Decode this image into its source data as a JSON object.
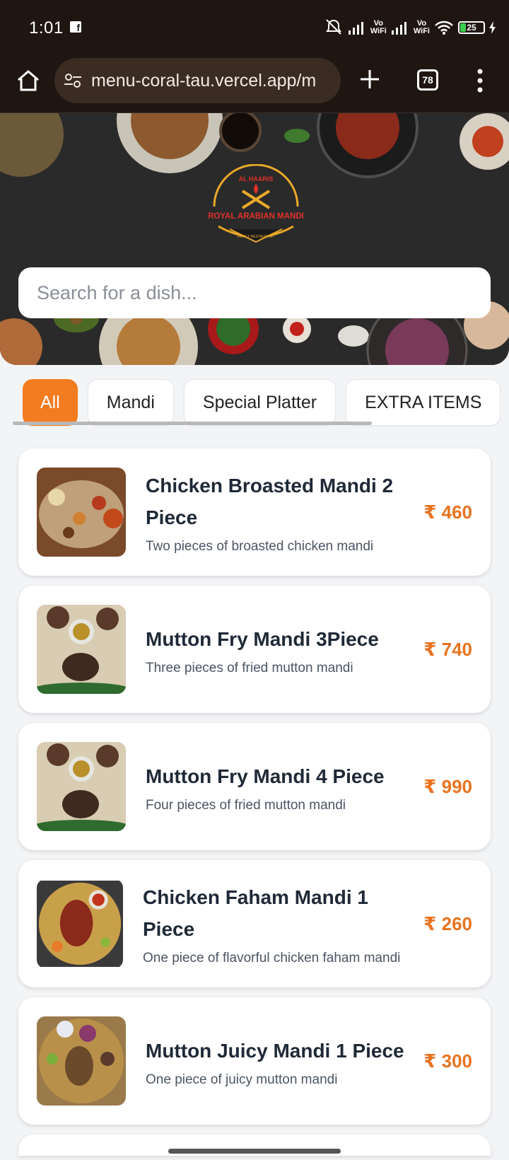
{
  "status_bar": {
    "time": "1:01",
    "battery": "25",
    "vowifi_1": "Vo\nWiFi",
    "vowifi_2": "Vo\nWiFi"
  },
  "browser": {
    "url": "menu-coral-tau.vercel.app/m",
    "tab_count": "78"
  },
  "hero": {
    "logo_top": "AL HAARIS",
    "logo_main": "ROYAL ARABIAN MANDI",
    "logo_sub": "FAMILY RESTAURANT"
  },
  "search": {
    "placeholder": "Search for a dish..."
  },
  "categories": [
    {
      "label": "All",
      "active": true
    },
    {
      "label": "Mandi",
      "active": false
    },
    {
      "label": "Special Platter",
      "active": false
    },
    {
      "label": "EXTRA ITEMS",
      "active": false
    }
  ],
  "menu_items": [
    {
      "name": "Chicken Broasted Mandi 2 Piece",
      "description": "Two pieces of broasted chicken mandi",
      "price": "₹ 460"
    },
    {
      "name": "Mutton Fry Mandi 3Piece",
      "description": "Three pieces of fried mutton mandi",
      "price": "₹ 740"
    },
    {
      "name": "Mutton Fry Mandi 4 Piece",
      "description": "Four pieces of fried mutton mandi",
      "price": "₹ 990"
    },
    {
      "name": "Chicken Faham Mandi 1 Piece",
      "description": "One piece of flavorful chicken faham mandi",
      "price": "₹ 260"
    },
    {
      "name": "Mutton Juicy Mandi 1 Piece",
      "description": "One piece of juicy mutton mandi",
      "price": "₹ 300"
    }
  ],
  "colors": {
    "accent": "#f47c20",
    "price": "#e97320",
    "chrome": "#1f1612"
  }
}
